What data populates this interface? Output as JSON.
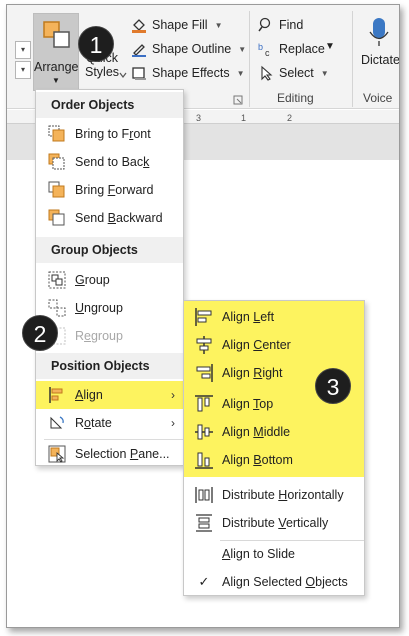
{
  "ribbon": {
    "arrange": {
      "label": "Arrange",
      "icon": "arrange-icon"
    },
    "quick_styles": {
      "label_line1": "Quick",
      "label_line2": "Styles"
    },
    "shape_fill": "Shape Fill",
    "shape_outline": "Shape Outline",
    "shape_effects": "Shape Effects",
    "find": "Find",
    "replace": "Replace",
    "select": "Select",
    "editing_group": "Editing",
    "dictate": "Dictate",
    "voice_group": "Voice",
    "ruler_marks": [
      "3",
      "1",
      "2"
    ]
  },
  "arrange_menu": {
    "order_header": "Order Objects",
    "bring_to_front": {
      "pre": "Bring to F",
      "key": "r",
      "post": "ont"
    },
    "send_to_back": {
      "pre": "Send to Bac",
      "key": "k",
      "post": ""
    },
    "bring_forward": {
      "pre": "Bring ",
      "key": "F",
      "post": "orward"
    },
    "send_backward": {
      "pre": "Send ",
      "key": "B",
      "post": "ackward"
    },
    "group_header": "Group Objects",
    "group": {
      "pre": "",
      "key": "G",
      "post": "roup"
    },
    "ungroup": {
      "pre": "",
      "key": "U",
      "post": "ngroup"
    },
    "regroup": {
      "pre": "R",
      "key": "e",
      "post": "group"
    },
    "position_header": "Position Objects",
    "align": {
      "pre": "",
      "key": "A",
      "post": "lign"
    },
    "rotate": {
      "pre": "R",
      "key": "o",
      "post": "tate"
    },
    "selection_pane": {
      "pre": "Selection ",
      "key": "P",
      "post": "ane..."
    }
  },
  "align_submenu": {
    "align_left": {
      "pre": "Align ",
      "key": "L",
      "post": "eft"
    },
    "align_center": {
      "pre": "Align ",
      "key": "C",
      "post": "enter"
    },
    "align_right": {
      "pre": "Align ",
      "key": "R",
      "post": "ight"
    },
    "align_top": {
      "pre": "Align ",
      "key": "T",
      "post": "op"
    },
    "align_middle": {
      "pre": "Align ",
      "key": "M",
      "post": "iddle"
    },
    "align_bottom": {
      "pre": "Align ",
      "key": "B",
      "post": "ottom"
    },
    "distribute_horizontally": {
      "pre": "Distribute ",
      "key": "H",
      "post": "orizontally"
    },
    "distribute_vertically": {
      "pre": "Distribute ",
      "key": "V",
      "post": "ertically"
    },
    "align_to_slide": {
      "pre": "",
      "key": "A",
      "post": "lign to Slide"
    },
    "align_selected": {
      "pre": "Align Selected ",
      "key": "O",
      "post": "bjects"
    },
    "checkmark": "✓"
  },
  "callouts": [
    "1",
    "2",
    "3"
  ],
  "colors": {
    "highlight": "#fdf35f",
    "callout_bg": "#1e1e1e"
  }
}
